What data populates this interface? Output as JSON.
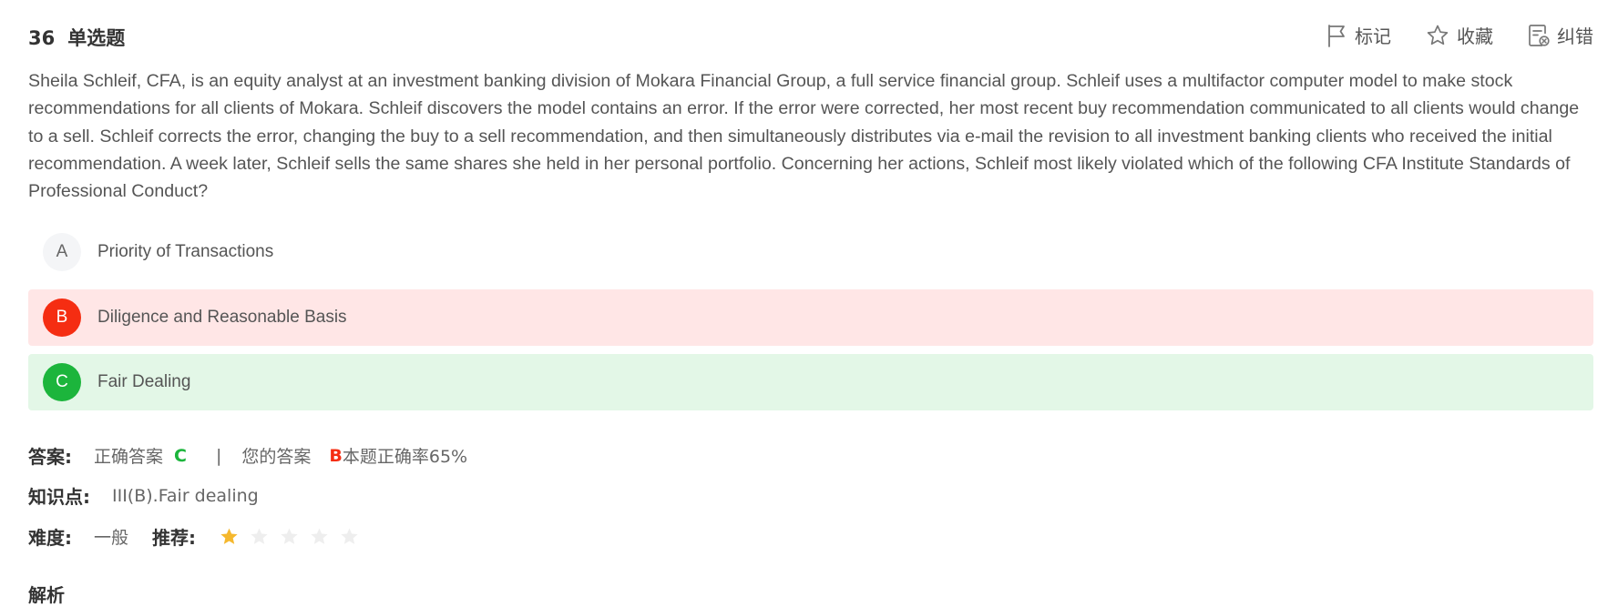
{
  "question": {
    "number": "36",
    "type": "单选题",
    "stem": "Sheila Schleif, CFA, is an equity analyst at an investment banking division of Mokara Financial Group, a full service financial group. Schleif uses a multifactor computer model to make stock recommendations for all clients of Mokara. Schleif discovers the model contains an error. If the error were corrected, her most recent buy recommendation communicated to all clients would change to a sell. Schleif corrects the error, changing the buy to a sell recommendation, and then simultaneously distributes via e-mail the revision to all investment banking clients who received the initial recommendation. A week later, Schleif sells the same shares she held in her personal portfolio. Concerning her actions, Schleif most likely violated which of the following CFA Institute Standards of Professional Conduct?"
  },
  "actions": {
    "mark_label": "标记",
    "favorite_label": "收藏",
    "report_label": "纠错",
    "mark_icon": "flag-icon",
    "favorite_icon": "star-outline-icon",
    "report_icon": "report-error-icon"
  },
  "options": [
    {
      "letter": "A",
      "text": "Priority of Transactions",
      "state": "default"
    },
    {
      "letter": "B",
      "text": "Diligence and Reasonable Basis",
      "state": "wrong-selected"
    },
    {
      "letter": "C",
      "text": "Fair Dealing",
      "state": "correct"
    }
  ],
  "answer": {
    "label": "答案:",
    "correct_text": "正确答案",
    "correct_letter": "C",
    "separator": "|",
    "your_text": "您的答案",
    "your_letter": "B",
    "rate_text": "本题正确率65%"
  },
  "knowledge": {
    "label": "知识点:",
    "value": "III(B).Fair dealing"
  },
  "difficulty": {
    "label": "难度:",
    "value": "一般",
    "recommend_label": "推荐:",
    "rating": 1,
    "max_rating": 5
  },
  "analysis": {
    "title": "解析"
  },
  "colors": {
    "wrong": "#f52d12",
    "wrong_bg": "#ffe6e6",
    "correct": "#1cb53c",
    "correct_bg": "#e3f7e7",
    "star_on": "#f5b82e",
    "star_off": "#eeeeee"
  }
}
